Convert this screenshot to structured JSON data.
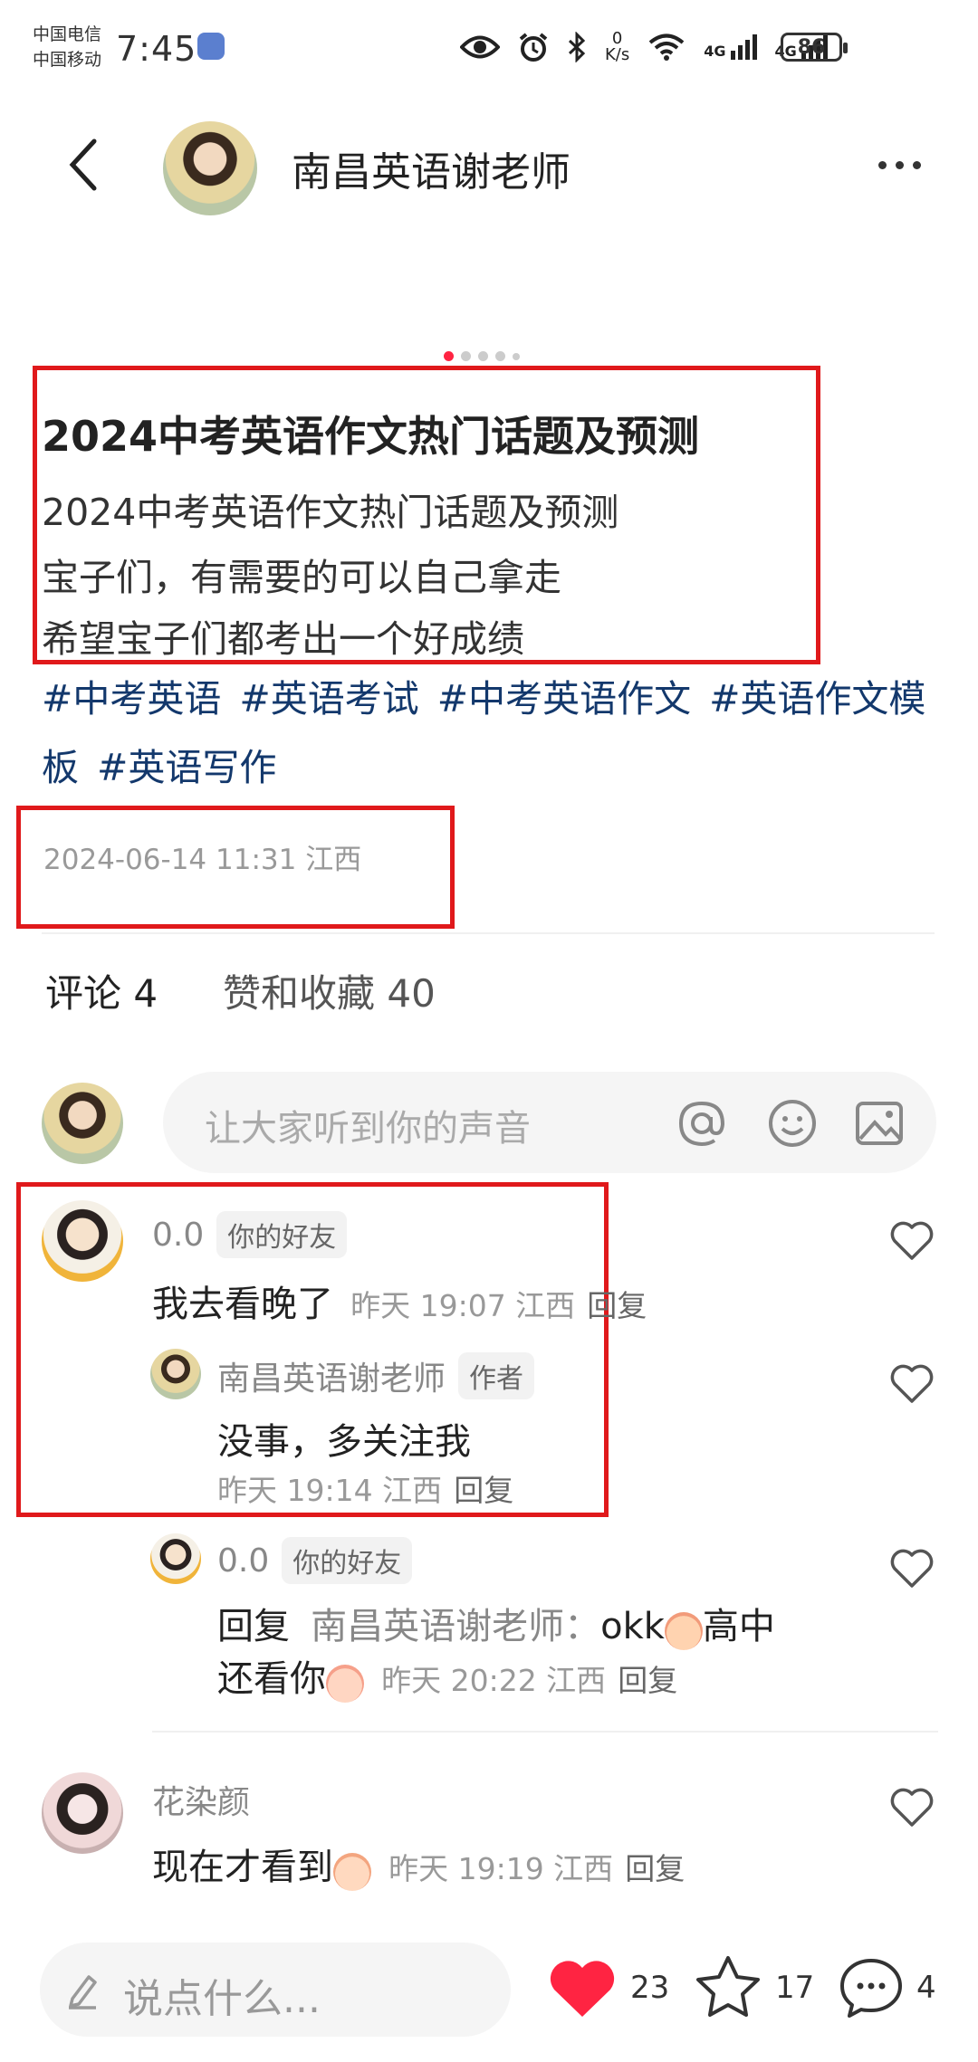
{
  "status_bar": {
    "carrier_1": "中国电信",
    "carrier_2": "中国移动",
    "time": "7:45",
    "net_speed_top": "0",
    "net_speed_unit": "K/s",
    "signal_1": "4G",
    "signal_2": "4G",
    "battery": "86"
  },
  "header": {
    "title": "南昌英语谢老师",
    "icons": [
      "back-arrow-icon",
      "more-dots-icon"
    ]
  },
  "post": {
    "title": "2024中考英语作文热门话题及预测",
    "lines": [
      "2024中考英语作文热门话题及预测",
      "宝子们，有需要的可以自己拿走",
      "希望宝子们都考出一个好成绩"
    ],
    "tags": [
      "#中考英语",
      "#英语考试",
      "#中考英语作文",
      "#英语作文模板",
      "#英语写作"
    ],
    "date": "2024-06-14 11:31 江西"
  },
  "tabs": {
    "comments": "评论 4",
    "likes": "赞和收藏 40"
  },
  "comment_input": {
    "placeholder": "让大家听到你的声音",
    "icons": [
      "at-icon",
      "emoji-icon",
      "image-icon"
    ]
  },
  "comments": {
    "c1": {
      "user": "0.0",
      "badge": "你的好友",
      "text": "我去看晚了",
      "meta": "昨天 19:07 江西",
      "reply": "回复"
    },
    "c1r1": {
      "user": "南昌英语谢老师",
      "badge": "作者",
      "text": "没事，多关注我",
      "meta": "昨天 19:14 江西",
      "reply": "回复"
    },
    "c1r2": {
      "user": "0.0",
      "badge": "你的好友",
      "reply_prefix": "回复",
      "reply_to": "南昌英语谢老师：",
      "text_a": "okk",
      "text_b": "高中",
      "text_c": "还看你",
      "meta": "昨天 20:22 江西",
      "reply": "回复"
    },
    "c2": {
      "user": "花染颜",
      "text": "现在才看到",
      "meta": "昨天 19:19 江西",
      "reply": "回复"
    }
  },
  "bottom_bar": {
    "placeholder": "说点什么...",
    "likes": "23",
    "stars": "17",
    "comments": "4"
  },
  "colors": {
    "accent_red": "#ff2442",
    "annotation_red": "#e0191b",
    "tag_blue": "#13386c"
  }
}
